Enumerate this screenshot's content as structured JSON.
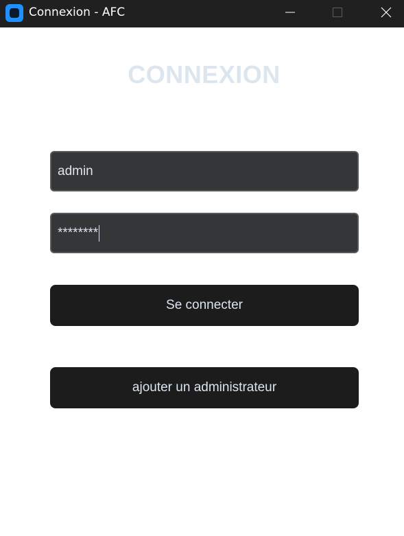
{
  "window": {
    "title": "Connexion - AFC"
  },
  "form": {
    "heading": "CONNEXION",
    "username_value": "admin",
    "password_value": "********",
    "login_label": "Se connecter",
    "add_admin_label": "ajouter un administrateur"
  },
  "colors": {
    "titlebar": "#202020",
    "heading": "#dde5ee",
    "field_bg": "#343638",
    "field_border": "#565b5e",
    "button_bg": "#1c1c1d",
    "accent": "#1e90ff"
  },
  "icons": {
    "app": "app-icon",
    "minimize": "minimize-icon",
    "maximize": "maximize-icon",
    "close": "close-icon"
  }
}
